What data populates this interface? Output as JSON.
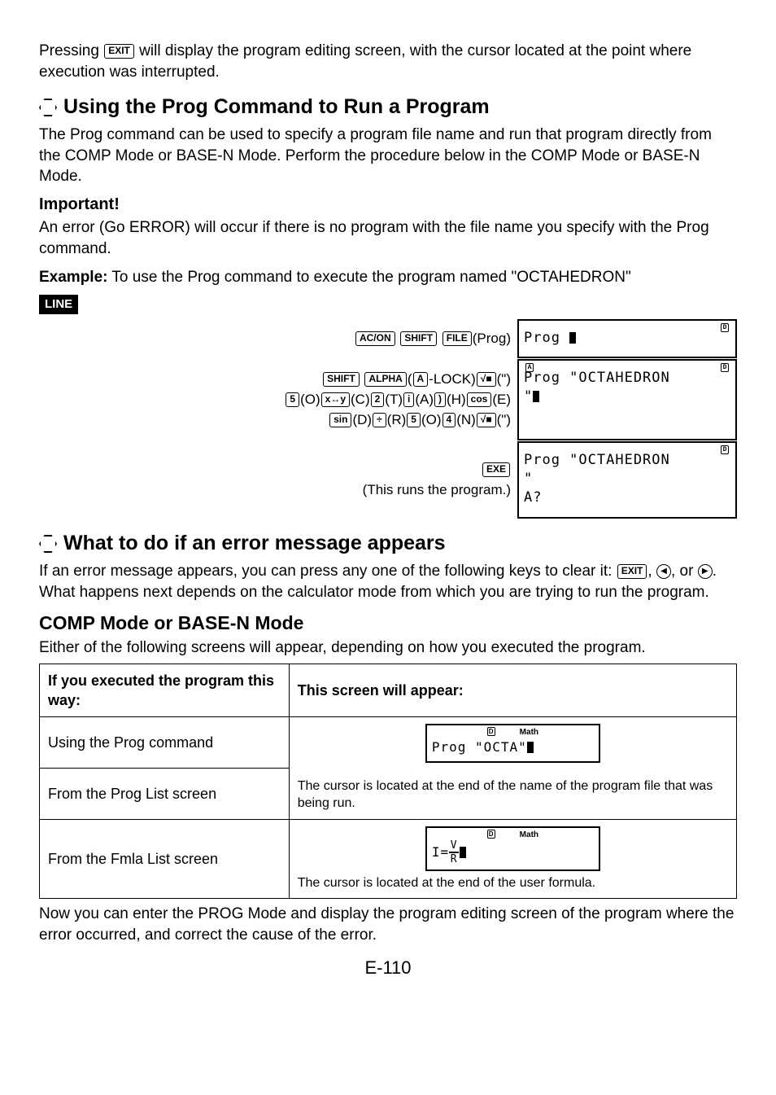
{
  "intro_text_part1": "Pressing ",
  "intro_text_part2": " will display the program editing screen, with the cursor located at the point where execution was interrupted.",
  "keys": {
    "exit": "EXIT",
    "acon": "AC/ON",
    "shift": "SHIFT",
    "file": "FILE",
    "alpha": "ALPHA",
    "a": "A",
    "sqrt": "√■",
    "five": "5",
    "xy": "x↔y",
    "two": "2",
    "i": "i",
    "rparen": ")",
    "cos": "cos",
    "sin": "sin",
    "div": "÷",
    "four": "4",
    "exe": "EXE"
  },
  "section1": {
    "heading": "Using the Prog Command to Run a Program",
    "body": "The Prog command can be used to specify a program file name and run that program directly from the COMP Mode or BASE-N Mode. Perform the procedure below in the COMP Mode or BASE-N Mode.",
    "important_label": "Important!",
    "important_body": "An error (Go ERROR) will occur if there is no program with the file name you specify with the Prog command.",
    "example_label": "Example:",
    "example_body": " To use the Prog command to execute the program named \"OCTAHEDRON\"",
    "line_badge": "LINE",
    "step1_suffix": "(Prog)",
    "step2_l1_suffixes": [
      "-LOCK)",
      "(\")"
    ],
    "step2_l2": [
      "(O)",
      "(C)",
      "(T)",
      "(A)",
      "(H)",
      "(E)"
    ],
    "step2_l3": [
      "(D)",
      "(R)",
      "(O)",
      "(N)",
      "(\")"
    ],
    "step3_note": "(This runs the program.)",
    "lcd1": "Prog ",
    "lcd2_l1": "Prog \"OCTAHEDRON",
    "lcd2_l2": "\"",
    "lcd3_l1": "Prog \"OCTAHEDRON",
    "lcd3_l2": "\"",
    "lcd3_l3": "A?",
    "indicator_d": "D",
    "indicator_a": "A"
  },
  "section2": {
    "heading": "What to do if an error message appears",
    "body_p1": "If an error message appears, you can press any one of the following keys to clear it: ",
    "body_p2": ", ",
    "body_p3": ", or ",
    "body_p4": ". What happens next depends on the calculator mode from which you are trying to run the program.",
    "arrow_left": "◀",
    "arrow_right": "▶"
  },
  "section3": {
    "heading": "COMP Mode or BASE-N Mode",
    "intro": "Either of the following screens will appear, depending on how you executed the program.",
    "th1": "If you executed the program this way:",
    "th2": "This screen will appear:",
    "row1_left": "Using the Prog command",
    "row2_left": "From the Prog List screen",
    "row3_left": "From the Fmla List screen",
    "row1_lcd": "Prog \"OCTA\"",
    "row2_note": "The cursor is located at the end of the name of the program file that was being run.",
    "row3_formula_left": "I=",
    "row3_formula_top": "V",
    "row3_formula_bottom": "R",
    "row3_note": "The cursor is located at the end of the user formula.",
    "math_indicator": "Math",
    "d_indicator": "D"
  },
  "closing": "Now you can enter the PROG Mode and display the program editing screen of the program where the error occurred, and correct the cause of the error.",
  "page_number": "E-110"
}
